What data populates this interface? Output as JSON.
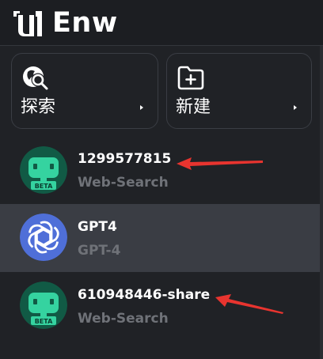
{
  "app": {
    "title": "Enw",
    "logo_icon": "enw-logo-icon"
  },
  "actions": [
    {
      "label": "探索",
      "icon": "explore-search-icon"
    },
    {
      "label": "新建",
      "icon": "new-folder-icon"
    }
  ],
  "list": [
    {
      "title": "1299577815",
      "subtitle": "Web-Search",
      "avatar": "beta-bot-avatar",
      "badge": "BETA",
      "selected": false
    },
    {
      "title": "GPT4",
      "subtitle": "GPT-4",
      "avatar": "openai-avatar",
      "selected": true
    },
    {
      "title": "610948446-share",
      "subtitle": "Web-Search",
      "avatar": "beta-bot-avatar",
      "badge": "BETA",
      "selected": false
    }
  ],
  "colors": {
    "background": "#202226",
    "selected_row": "#3a3d44",
    "subtitle_text": "#6f7278",
    "bot_avatar_bg": "#115a45",
    "bot_accent": "#35d3a0",
    "openai_avatar_bg": "#4f6fd8",
    "annotation_arrow": "#e8342f"
  }
}
